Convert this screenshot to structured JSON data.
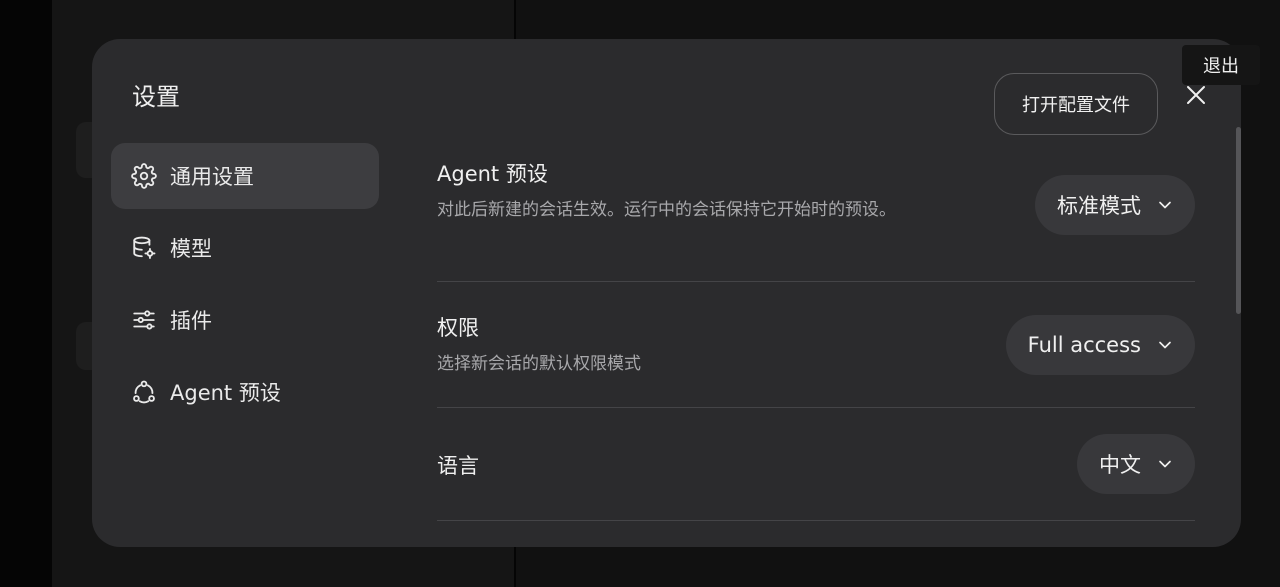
{
  "modal": {
    "title": "设置",
    "open_config_label": "打开配置文件",
    "close_icon": "close-icon"
  },
  "nav": {
    "items": [
      {
        "label": "通用设置",
        "icon": "gear-icon",
        "active": true
      },
      {
        "label": "模型",
        "icon": "database-gear-icon",
        "active": false
      },
      {
        "label": "插件",
        "icon": "sliders-icon",
        "active": false
      },
      {
        "label": "Agent 预设",
        "icon": "nodes-icon",
        "active": false
      }
    ]
  },
  "settings": {
    "agent_preset": {
      "title": "Agent 预设",
      "description": "对此后新建的会话生效。运行中的会话保持它开始时的预设。",
      "value": "标准模式"
    },
    "permissions": {
      "title": "权限",
      "description": "选择新会话的默认权限模式",
      "value": "Full access"
    },
    "language": {
      "title": "语言",
      "value": "中文"
    }
  },
  "tooltip": {
    "exit_label": "退出"
  },
  "colors": {
    "modal_bg": "#2b2b2d",
    "active_nav_bg": "#3d3d40",
    "dropdown_bg": "#38383b",
    "text_primary": "#f0f0f0",
    "text_secondary": "#a8a8ab"
  }
}
